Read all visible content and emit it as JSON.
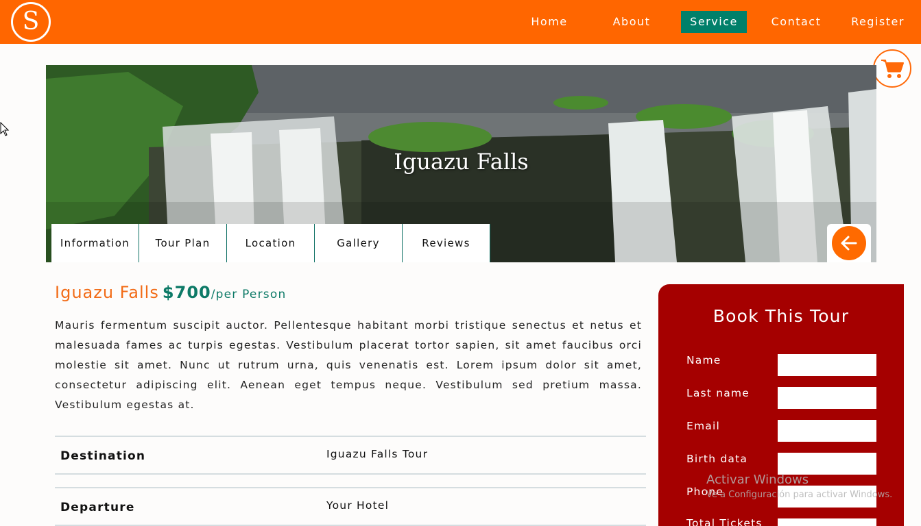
{
  "logo": {
    "letter": "S"
  },
  "nav": {
    "items": [
      {
        "label": "Home",
        "active": false
      },
      {
        "label": "About",
        "active": false
      },
      {
        "label": "Service",
        "active": true
      },
      {
        "label": "Contact",
        "active": false
      },
      {
        "label": "Register",
        "active": false
      }
    ]
  },
  "hero": {
    "title": "Iguazu Falls",
    "tabs": [
      "Information",
      "Tour Plan",
      "Location",
      "Gallery",
      "Reviews"
    ]
  },
  "tour": {
    "name": "Iguazu Falls",
    "price": "$700",
    "per": "/per Person",
    "description": "Mauris fermentum suscipit auctor. Pellentesque habitant morbi tristique senectus et netus et malesuada fames ac turpis egestas. Vestibulum placerat tortor sapien, sit amet faucibus orci molestie sit amet. Nunc ut rutrum urna, quis venenatis est. Lorem ipsum dolor sit amet, consectetur adipiscing elit. Aenean eget tempus neque. Vestibulum sed pretium massa. Vestibulum egestas at.",
    "details": [
      {
        "label": "Destination",
        "value": "Iguazu Falls Tour"
      },
      {
        "label": "Departure",
        "value": "Your Hotel"
      }
    ]
  },
  "booking": {
    "title": "Book This Tour",
    "fields": [
      "Name",
      "Last name",
      "Email",
      "Birth data",
      "Phone",
      "Total Tickets"
    ]
  },
  "watermark": {
    "line1": "Activar Windows",
    "line2": "Ve a Configuración para activar Windows."
  },
  "colors": {
    "header": "#ff6600",
    "active_nav": "#00806a",
    "accent_orange": "#f26b16",
    "price_teal": "#0d7a67",
    "booking_red": "#a50000"
  }
}
